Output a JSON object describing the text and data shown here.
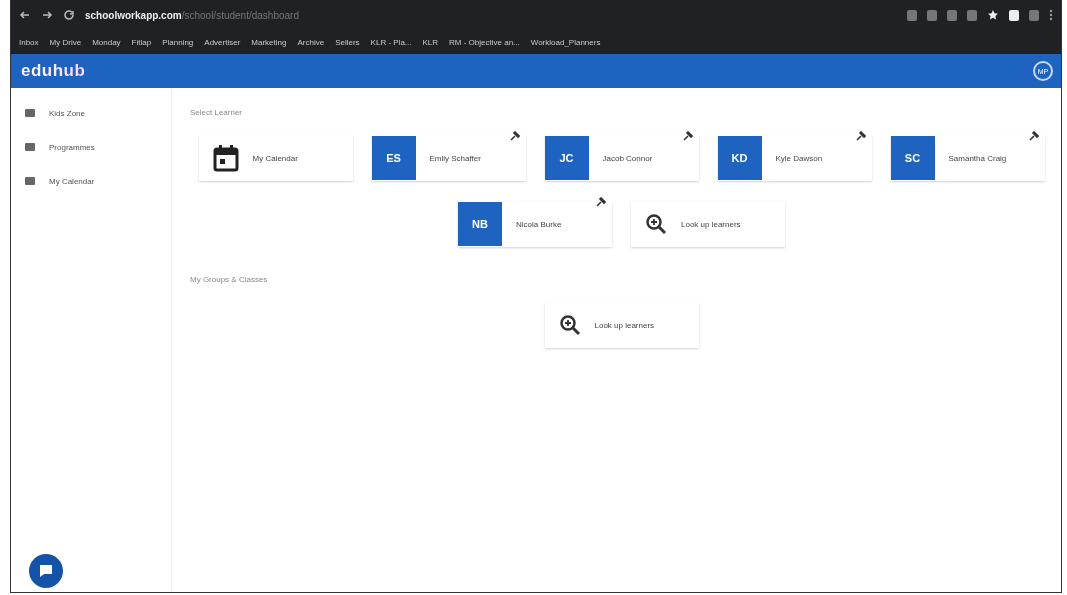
{
  "browser": {
    "url_domain": "schoolworkapp.com",
    "url_path": "/school/student/dashboard",
    "bookmarks": [
      {
        "label": "Inbox"
      },
      {
        "label": "My Drive"
      },
      {
        "label": "Monday"
      },
      {
        "label": "Fitlap"
      },
      {
        "label": "Planning"
      },
      {
        "label": "Advertiser"
      },
      {
        "label": "Marketing"
      },
      {
        "label": "Archive"
      },
      {
        "label": "Sellers"
      },
      {
        "label": "KLR - Pla..."
      },
      {
        "label": "KLR"
      },
      {
        "label": "RM - Objective an..."
      },
      {
        "label": "Workload_Planners"
      }
    ]
  },
  "app_bar": {
    "logo": "eduhub",
    "avatar": "MP"
  },
  "sidebar": {
    "items": [
      {
        "label": "Kids Zone",
        "selected": false
      },
      {
        "label": "Programmes",
        "selected": false
      },
      {
        "label": "My Calendar",
        "selected": false
      }
    ]
  },
  "learners_section": {
    "title": "Select Learner",
    "cards": [
      {
        "kind": "calendar",
        "label": "My Calendar"
      },
      {
        "kind": "learner",
        "initials": "ES",
        "label": "Emily Schaffer",
        "pinned": true
      },
      {
        "kind": "learner",
        "initials": "JC",
        "label": "Jacob Connor",
        "pinned": true
      },
      {
        "kind": "learner",
        "initials": "KD",
        "label": "Kyle Dawson",
        "pinned": true
      },
      {
        "kind": "learner",
        "initials": "SC",
        "label": "Samantha Craig",
        "pinned": true
      },
      {
        "kind": "learner",
        "initials": "NB",
        "label": "Nicola Burke",
        "pinned": true
      },
      {
        "kind": "search",
        "label": "Look up learners"
      }
    ]
  },
  "groups_section": {
    "title": "My Groups & Classes",
    "cards": [
      {
        "kind": "search",
        "label": "Look up learners"
      }
    ]
  }
}
